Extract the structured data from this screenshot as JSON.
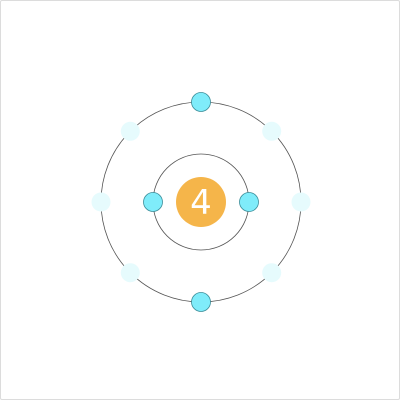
{
  "atom": {
    "nucleus": {
      "label": "4",
      "color": "#f5b54a"
    },
    "shells": [
      {
        "electrons": [
          {
            "angle_deg": 0,
            "state": "filled"
          },
          {
            "angle_deg": 180,
            "state": "filled"
          }
        ]
      },
      {
        "electrons": [
          {
            "angle_deg": 270,
            "state": "filled"
          },
          {
            "angle_deg": 90,
            "state": "filled"
          },
          {
            "angle_deg": 315,
            "state": "empty"
          },
          {
            "angle_deg": 225,
            "state": "empty"
          },
          {
            "angle_deg": 180,
            "state": "empty"
          },
          {
            "angle_deg": 135,
            "state": "empty"
          },
          {
            "angle_deg": 45,
            "state": "empty"
          },
          {
            "angle_deg": 0,
            "state": "empty"
          }
        ]
      }
    ],
    "colors": {
      "electron_filled": "#7fecfa",
      "electron_empty": "#e6fbfd",
      "orbit_stroke": "#555555"
    }
  }
}
